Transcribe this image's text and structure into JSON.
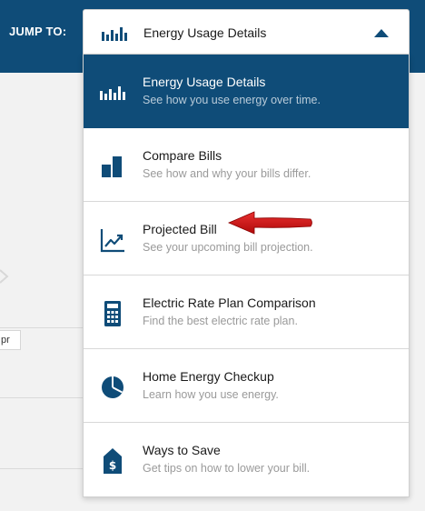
{
  "header": {
    "jump_to_label": "JUMP TO:"
  },
  "dropdown": {
    "selected_label": "Energy Usage Details",
    "selected_icon": "bar-chart-icon",
    "caret_icon": "caret-up-icon",
    "expanded": true
  },
  "menu": {
    "items": [
      {
        "title": "Energy Usage Details",
        "description": "See how you use energy over time.",
        "icon": "bar-chart-icon",
        "active": true
      },
      {
        "title": "Compare Bills",
        "description": "See how and why your bills differ.",
        "icon": "two-bars-icon",
        "active": false
      },
      {
        "title": "Projected Bill",
        "description": "See your upcoming bill projection.",
        "icon": "trend-line-icon",
        "active": false
      },
      {
        "title": "Electric Rate Plan Comparison",
        "description": "Find the best electric rate plan.",
        "icon": "calculator-icon",
        "active": false
      },
      {
        "title": "Home Energy Checkup",
        "description": "Learn how you use energy.",
        "icon": "pie-chart-icon",
        "active": false
      },
      {
        "title": "Ways to Save",
        "description": "Get tips on how to lower your bill.",
        "icon": "price-tag-dollar-icon",
        "active": false
      }
    ]
  },
  "background": {
    "pill_text": "pr"
  },
  "colors": {
    "brand_blue": "#0f4c78",
    "annotation_red": "#cc1111",
    "muted_text": "#9a9a9a"
  }
}
